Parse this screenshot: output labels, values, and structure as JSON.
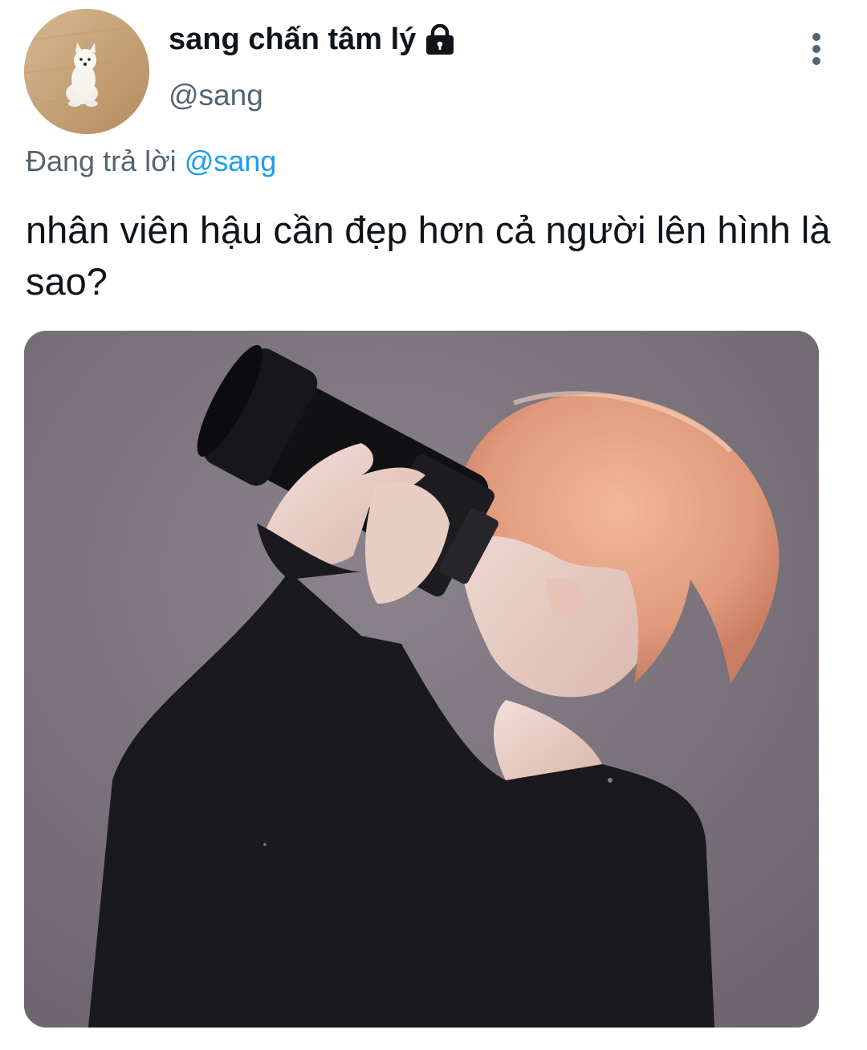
{
  "tweet": {
    "display_name": "sang chấn tâm lý",
    "handle": "@sang",
    "reply_prefix": "Đang trả lời",
    "reply_mention": "@sang",
    "text": "nhân viên hậu cần đẹp hơn cả người lên hình là sao?"
  },
  "icons": {
    "lock": "lock-icon",
    "more": "more-vertical-icon"
  },
  "colors": {
    "text_primary": "#0f1419",
    "text_secondary": "#536471",
    "link": "#1d9bf0"
  }
}
